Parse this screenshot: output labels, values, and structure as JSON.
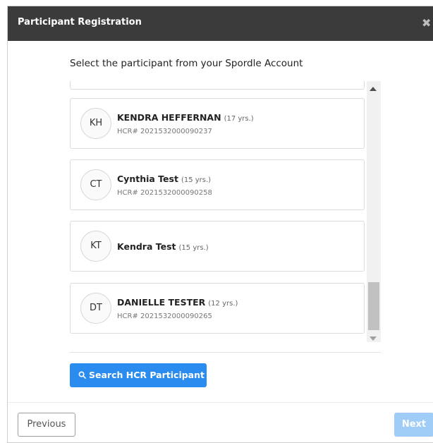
{
  "modal": {
    "title": "Participant Registration",
    "close_symbol": "✖"
  },
  "subtitle": "Select the participant from your Spordle Account",
  "participants": [
    {
      "initials": "KH",
      "name": "KENDRA HEFFERNAN",
      "age": "(17 yrs.)",
      "hcr": "HCR# 2021532000090237"
    },
    {
      "initials": "CT",
      "name": "Cynthia Test",
      "age": "(15 yrs.)",
      "hcr": "HCR# 2021532000090258"
    },
    {
      "initials": "KT",
      "name": "Kendra Test",
      "age": "(15 yrs.)",
      "hcr": ""
    },
    {
      "initials": "DT",
      "name": "DANIELLE TESTER",
      "age": "(12 yrs.)",
      "hcr": "HCR# 2021532000090265"
    }
  ],
  "buttons": {
    "search": "Search HCR Participant",
    "previous": "Previous",
    "next": "Next"
  },
  "colors": {
    "header_bg": "#3b3b3b",
    "primary": "#2b8cf0",
    "primary_disabled": "#9fcdf8"
  },
  "icons": {
    "close": "close-icon",
    "search": "search-icon",
    "scroll_up": "chevron-up-icon",
    "scroll_down": "chevron-down-icon"
  }
}
